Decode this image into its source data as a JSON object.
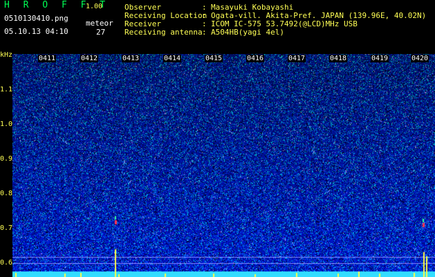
{
  "header": {
    "app_title": "H R O F F T",
    "version": "1.00",
    "filename": "0510130410.png",
    "datetime": "05.10.13 04:10",
    "meteor_label": "meteor",
    "meteor_count": "27",
    "info": [
      {
        "label": "Observer",
        "value": "Masayuki Kobayashi"
      },
      {
        "label": "Receiving Location",
        "value": "Ogata-vill. Akita-Pref. JAPAN (139.96E, 40.02N)"
      },
      {
        "label": "Receiver",
        "value": "ICOM IC-575 53.7492(@LCD)MHz USB"
      },
      {
        "label": "Receiving antenna",
        "value": "A504HB(yagi 4el)"
      }
    ]
  },
  "axis": {
    "unit": "kHz",
    "y_ticks": [
      "1.1",
      "1.0",
      "0.9",
      "0.8",
      "0.7",
      "0.6"
    ],
    "x_ticks": [
      "0411",
      "0412",
      "0413",
      "0414",
      "0415",
      "0416",
      "0417",
      "0418",
      "0419",
      "0420"
    ]
  },
  "colors": {
    "background": "#000000",
    "accent": "#ffff55",
    "title": "#00ff55"
  }
}
